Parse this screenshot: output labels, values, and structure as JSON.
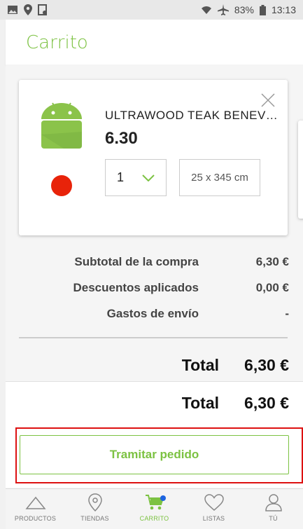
{
  "status_bar": {
    "battery": "83%",
    "time": "13:13"
  },
  "header": {
    "title": "Carrito"
  },
  "cart_item": {
    "name": "ULTRAWOOD TEAK BENEV…",
    "price": "6.30",
    "quantity": "1",
    "size": "25 x 345 cm",
    "color_swatch": "#e8230a"
  },
  "summary": {
    "subtotal_label": "Subtotal de la compra",
    "subtotal_value": "6,30 €",
    "discounts_label": "Descuentos aplicados",
    "discounts_value": "0,00 €",
    "shipping_label": "Gastos de envío",
    "shipping_value": "-",
    "total_label": "Total",
    "total_value": "6,30 €"
  },
  "checkout": {
    "total_label": "Total",
    "total_value": "6,30 €",
    "button_label": "Tramitar pedido"
  },
  "tabs": [
    {
      "label": "PRODUCTOS",
      "icon": "triangle-icon"
    },
    {
      "label": "TIENDAS",
      "icon": "map-pin-icon"
    },
    {
      "label": "CARRITO",
      "icon": "cart-icon",
      "active": true
    },
    {
      "label": "LISTAS",
      "icon": "heart-icon"
    },
    {
      "label": "TÚ",
      "icon": "user-icon"
    }
  ],
  "colors": {
    "accent": "#7cc242",
    "highlight": "#dd1111",
    "notification": "#1e64e0"
  }
}
